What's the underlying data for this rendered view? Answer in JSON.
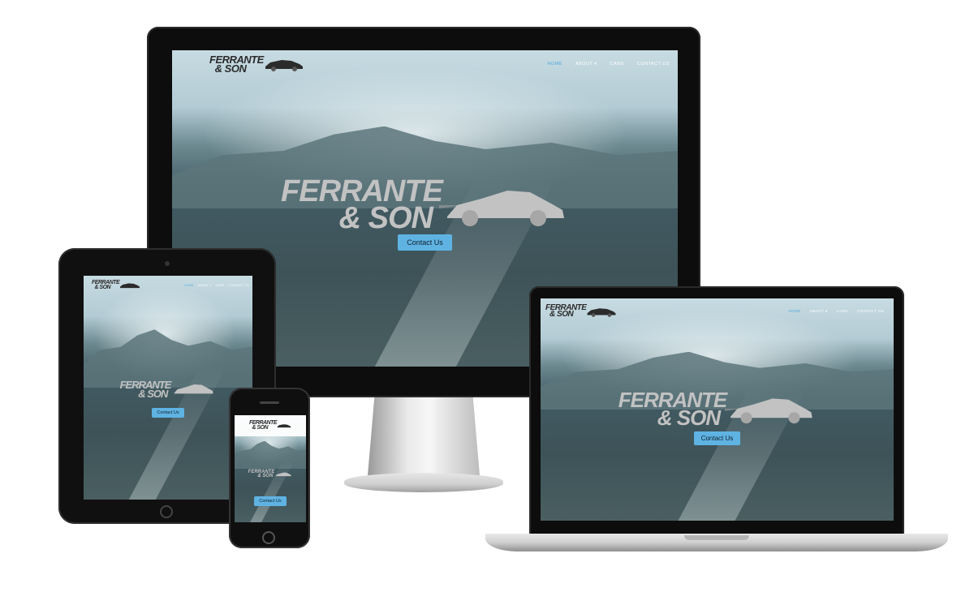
{
  "brand": {
    "line1": "FERRANTE",
    "line2": "& SON"
  },
  "nav": [
    {
      "label": "HOME",
      "active": true
    },
    {
      "label": "ABOUT ▾",
      "active": false
    },
    {
      "label": "CARS",
      "active": false
    },
    {
      "label": "CONTACT US",
      "active": false
    }
  ],
  "hero": {
    "title_line1": "FERRANTE",
    "title_line2": "& SON",
    "cta_label": "Contact Us"
  },
  "colors": {
    "accent": "#4fa6de",
    "cta": "#5fb3e3",
    "device_frame": "#0d0d0d"
  },
  "devices": [
    "monitor",
    "tablet",
    "laptop",
    "phone"
  ]
}
